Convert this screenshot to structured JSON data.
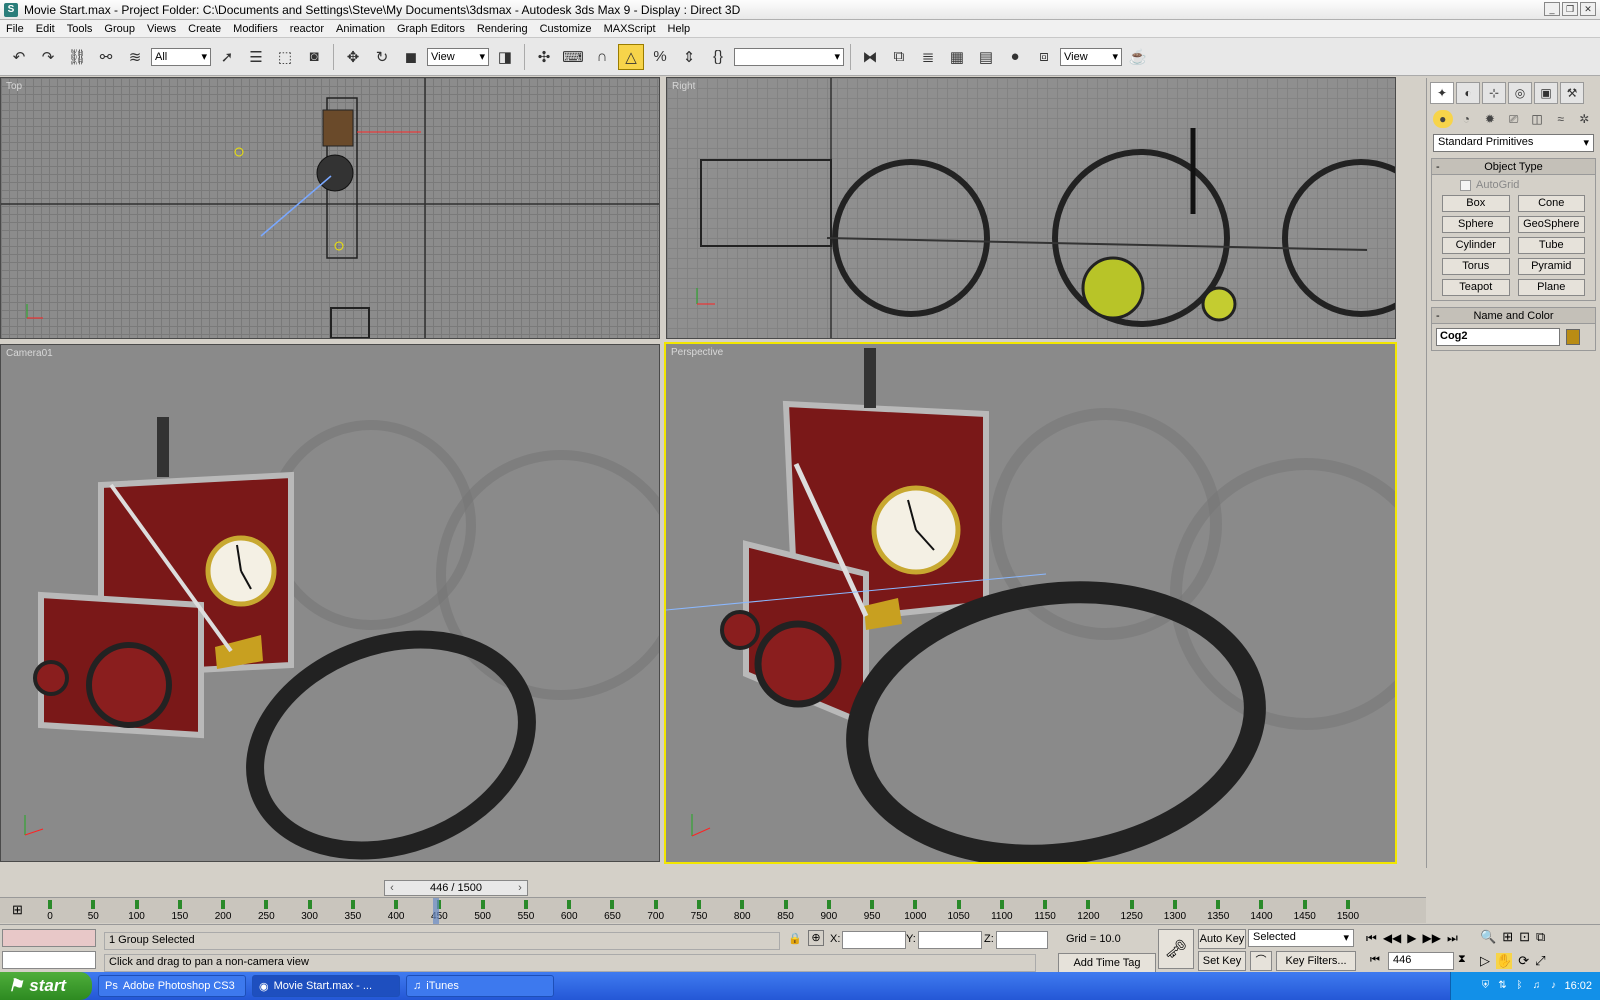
{
  "window": {
    "title": "Movie Start.max    - Project Folder: C:\\Documents and Settings\\Steve\\My Documents\\3dsmax    - Autodesk 3ds Max 9    - Display : Direct 3D"
  },
  "menu": [
    "File",
    "Edit",
    "Tools",
    "Group",
    "Views",
    "Create",
    "Modifiers",
    "reactor",
    "Animation",
    "Graph Editors",
    "Rendering",
    "Customize",
    "MAXScript",
    "Help"
  ],
  "toolbar": {
    "selection_filter": "All",
    "reference_coord": "View",
    "named_selection": "",
    "view_dropdown_2": "View"
  },
  "viewports": {
    "top": {
      "label": "Top"
    },
    "right": {
      "label": "Right"
    },
    "camera": {
      "label": "Camera01"
    },
    "perspective": {
      "label": "Perspective"
    }
  },
  "command_panel": {
    "category": "Standard Primitives",
    "object_type_title": "Object Type",
    "autogrid_label": "AutoGrid",
    "buttons": [
      "Box",
      "Cone",
      "Sphere",
      "GeoSphere",
      "Cylinder",
      "Tube",
      "Torus",
      "Pyramid",
      "Teapot",
      "Plane"
    ],
    "name_color_title": "Name and Color",
    "object_name": "Cog2",
    "object_color": "#b98c14"
  },
  "timeslider": {
    "value": "446 / 1500"
  },
  "trackbar": {
    "ticks": [
      "0",
      "50",
      "100",
      "150",
      "200",
      "250",
      "300",
      "350",
      "400",
      "450",
      "500",
      "550",
      "600",
      "650",
      "700",
      "750",
      "800",
      "850",
      "900",
      "950",
      "1000",
      "1050",
      "1100",
      "1150",
      "1200",
      "1250",
      "1300",
      "1350",
      "1400",
      "1450",
      "1500"
    ],
    "current_frame": 446,
    "total_frames": 1500
  },
  "status": {
    "selection": "1 Group Selected",
    "prompt": "Click and drag to pan a non-camera view",
    "x_label": "X:",
    "y_label": "Y:",
    "z_label": "Z:",
    "grid": "Grid = 10.0",
    "add_time_tag": "Add Time Tag",
    "auto_key": "Auto Key",
    "set_key": "Set Key",
    "key_mode": "Selected",
    "key_filters": "Key Filters...",
    "frame": "446"
  },
  "taskbar": {
    "start": "start",
    "items": [
      "Adobe Photoshop CS3",
      "Movie Start.max   - ...",
      "iTunes"
    ],
    "clock": "16:02"
  },
  "colors": {
    "active_viewport": "#f2e600",
    "active_tool": "#f7d44a",
    "body_red": "#8a1e1e"
  }
}
